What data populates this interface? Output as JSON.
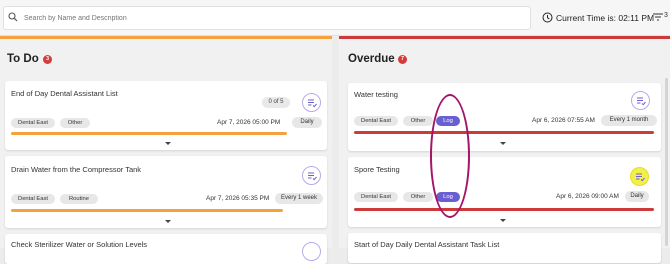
{
  "search": {
    "placeholder": "Search by Name and Description"
  },
  "time": {
    "label": "Current Time is: 02:11 PM"
  },
  "filter": {
    "count": "3"
  },
  "todo": {
    "title": "To Do",
    "badge": "3",
    "cards": [
      {
        "title": "End of Day Dental Assistant List",
        "count": "0 of 5",
        "tags": [
          "Dental East",
          "Other"
        ],
        "datetime": "Apr 7, 2026  05:00 PM",
        "freq": "Daily"
      },
      {
        "title": "Drain Water from the Compressor Tank",
        "tags": [
          "Dental East",
          "Routine"
        ],
        "datetime": "Apr 7, 2026  05:35 PM",
        "freq": "Every 1 week"
      },
      {
        "title": "Check Sterilizer Water or Solution Levels"
      }
    ]
  },
  "overdue": {
    "title": "Overdue",
    "badge": "7",
    "cards": [
      {
        "title": "Water testing",
        "tags": [
          "Dental East",
          "Other",
          "Log"
        ],
        "datetime": "Apr 6, 2026  07:55 AM",
        "freq": "Every 1 month"
      },
      {
        "title": "Spore Testing",
        "tags": [
          "Dental East",
          "Other",
          "Log"
        ],
        "datetime": "Apr 6, 2026  09:00 AM",
        "freq": "Daily"
      },
      {
        "title": "Start of Day Daily Dental Assistant Task List"
      }
    ]
  },
  "colors": {
    "todo_accent": "#f5a13d",
    "overdue_accent": "#cc3a3a",
    "log_tag": "#6a5fd0",
    "annotation_ellipse": "#a5136b",
    "annotation_highlight": "#f3f04a"
  }
}
